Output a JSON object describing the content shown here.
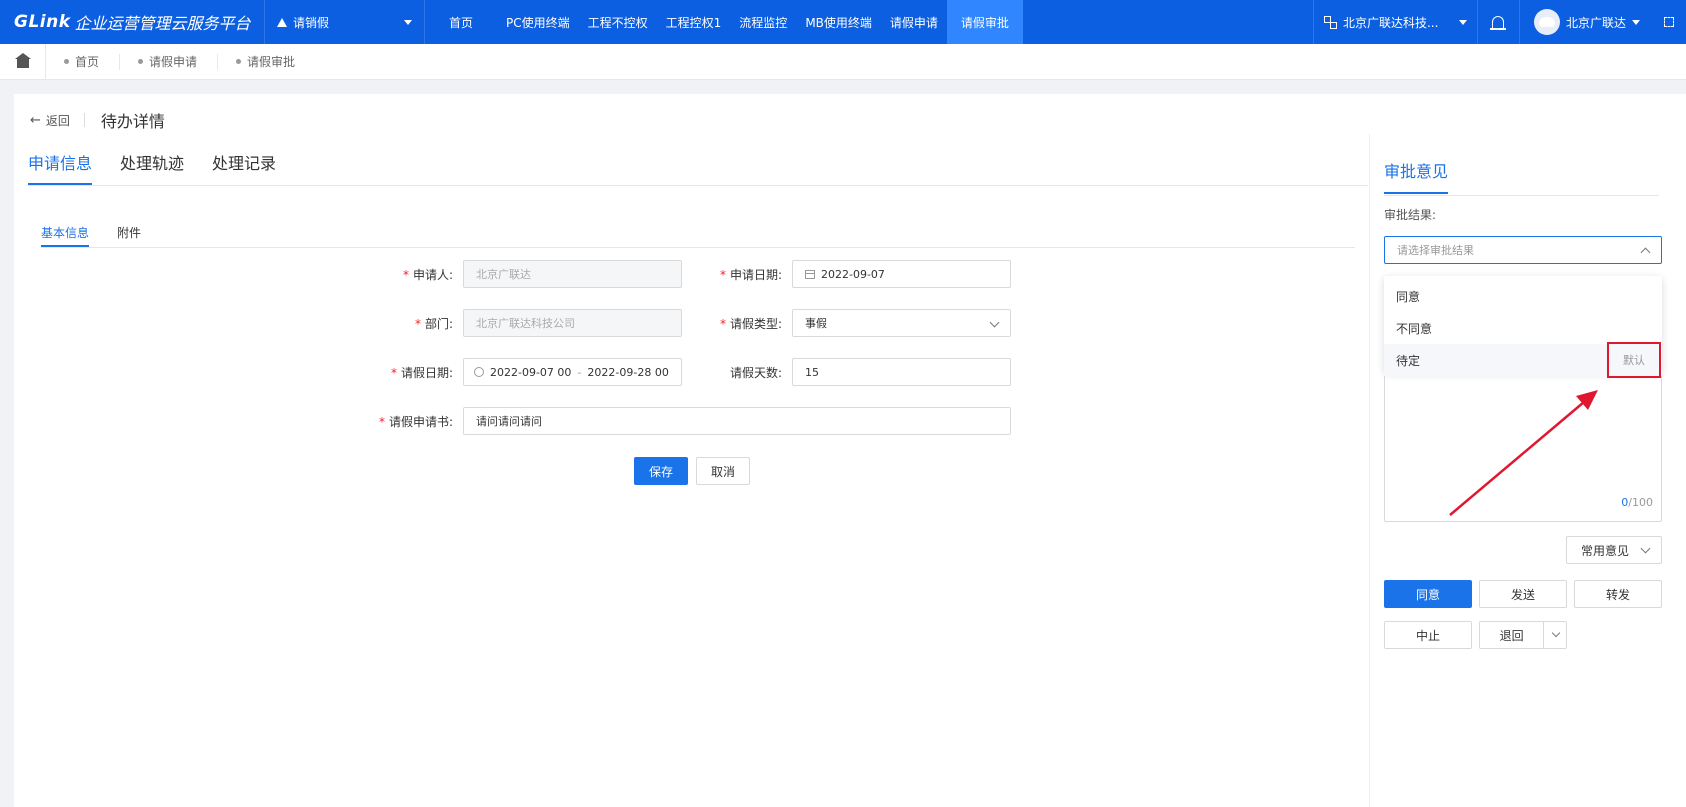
{
  "topbar": {
    "brand_logo": "GLink",
    "brand_title": "企业运营管理云服务平台",
    "app_select": "请销假",
    "nav": [
      "首页",
      "PC使用终端",
      "工程不控权",
      "工程控权1",
      "流程监控",
      "MB使用终端",
      "请假申请",
      "请假审批"
    ],
    "active_nav": "请假审批",
    "org": "北京广联达科技...",
    "user": "北京广联达",
    "color_primary": "#0c5fe0"
  },
  "breadcrumb": [
    "首页",
    "请假申请",
    "请假审批"
  ],
  "header": {
    "back": "返回",
    "title": "待办详情"
  },
  "tabs": [
    "申请信息",
    "处理轨迹",
    "处理记录"
  ],
  "subtabs": [
    "基本信息",
    "附件"
  ],
  "form": {
    "applicant_label": "申请人:",
    "applicant": "北京广联达",
    "apply_date_label": "申请日期:",
    "apply_date": "2022-09-07",
    "dept_label": "部门:",
    "dept": "北京广联达科技公司",
    "leave_type_label": "请假类型:",
    "leave_type": "事假",
    "leave_date_label": "请假日期:",
    "leave_start": "2022-09-07 00",
    "leave_end": "2022-09-28 00",
    "leave_sep": "-",
    "leave_days_label": "请假天数:",
    "leave_days": "15",
    "letter_label": "请假申请书:",
    "letter": "请问请问请问",
    "save": "保存",
    "cancel": "取消"
  },
  "approval": {
    "tab": "审批意见",
    "result_label": "审批结果:",
    "placeholder": "请选择审批结果",
    "options": [
      "同意",
      "不同意",
      "待定"
    ],
    "default_tag": "默认",
    "counter_current": "0",
    "counter_max": "/100",
    "common_opinion": "常用意见",
    "btn_agree": "同意",
    "btn_send": "发送",
    "btn_forward": "转发",
    "btn_stop": "中止",
    "btn_return": "退回",
    "highlight_color": "#e0182f"
  }
}
